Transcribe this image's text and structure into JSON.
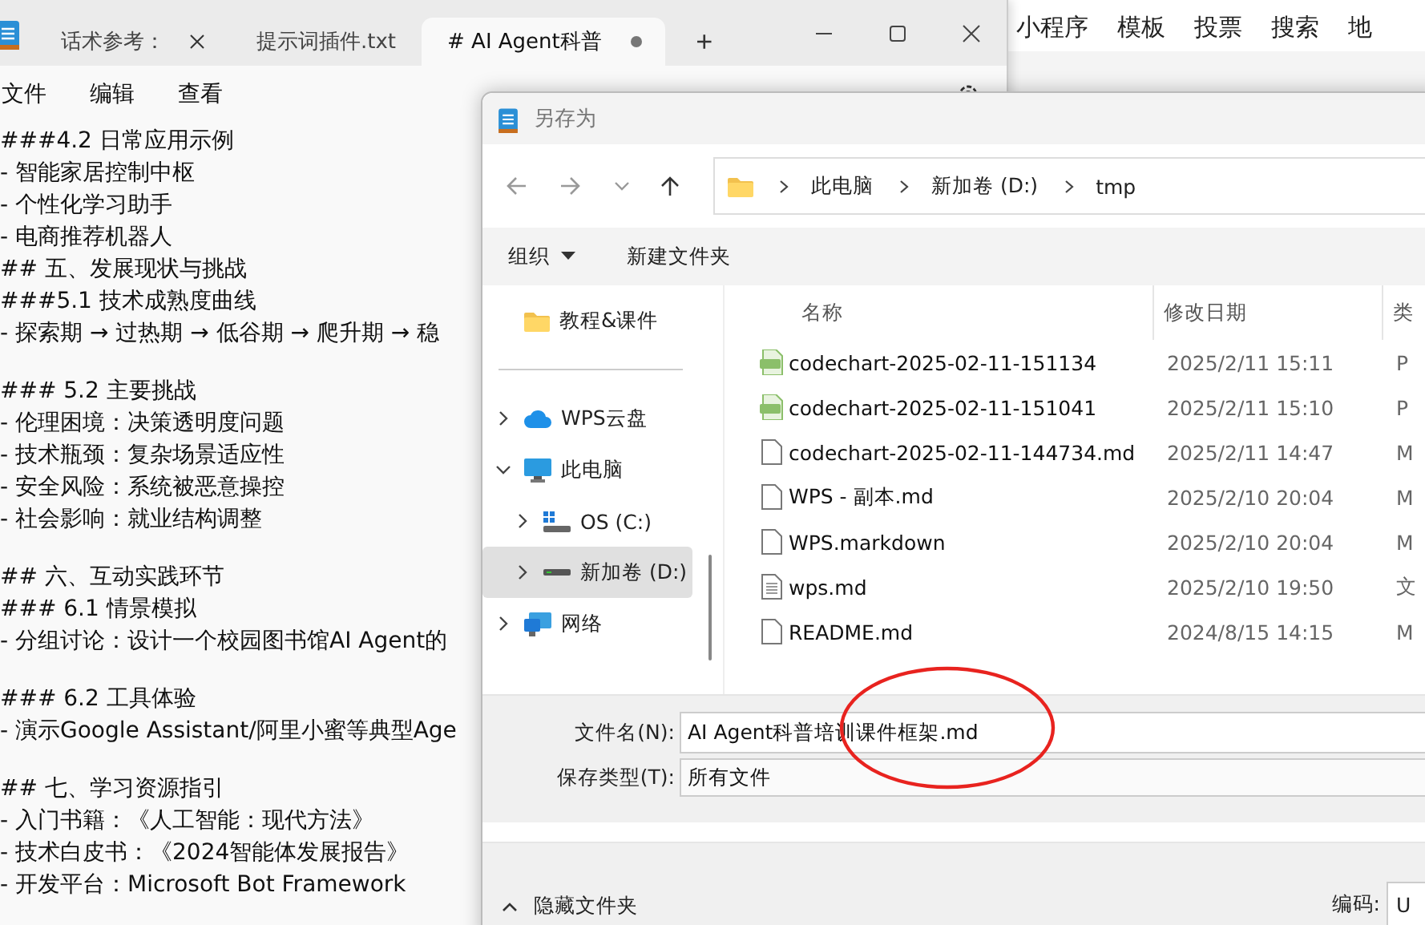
{
  "background_app": {
    "menu": [
      "小程序",
      "模板",
      "投票",
      "搜索",
      "地"
    ]
  },
  "notepad": {
    "tabs": [
      {
        "label": "话术参考：",
        "selected": false,
        "closable": true,
        "unsaved": false
      },
      {
        "label": "提示词插件.txt",
        "selected": false,
        "closable": false,
        "unsaved": false
      },
      {
        "label": "# AI Agent科普",
        "selected": true,
        "closable": false,
        "unsaved": true
      }
    ],
    "add_tab": "+",
    "menu": [
      "文件",
      "编辑",
      "查看"
    ],
    "paragraphs": [
      [
        "###4.2 日常应用示例",
        "- 智能家居控制中枢",
        "- 个性化学习助手",
        "- 电商推荐机器人",
        "## 五、发展现状与挑战",
        "###5.1 技术成熟度曲线",
        "- 探索期 → 过热期 → 低谷期 → 爬升期 → 稳"
      ],
      [
        "### 5.2 主要挑战",
        "- 伦理困境：决策透明度问题",
        "- 技术瓶颈：复杂场景适应性",
        "- 安全风险：系统被恶意操控",
        "- 社会影响：就业结构调整"
      ],
      [
        "## 六、互动实践环节",
        "### 6.1 情景模拟",
        "- 分组讨论：设计一个校园图书馆AI Agent的"
      ],
      [
        "### 6.2 工具体验",
        "- 演示Google Assistant/阿里小蜜等典型Age"
      ],
      [
        "## 七、学习资源指引",
        "- 入门书籍：《人工智能：现代方法》",
        "- 技术白皮书：《2024智能体发展报告》",
        "- 开发平台：Microsoft Bot Framework"
      ]
    ]
  },
  "dialog": {
    "title": "另存为",
    "breadcrumb": [
      "此电脑",
      "新加卷 (D:)",
      "tmp"
    ],
    "toolbar": {
      "organize": "组织",
      "new_folder": "新建文件夹"
    },
    "nav": [
      {
        "label": "教程&课件",
        "kind": "folder",
        "expandable": false,
        "selected": false,
        "child": false
      },
      {
        "label": "WPS云盘",
        "kind": "cloud",
        "expandable": true,
        "expanded": false,
        "selected": false,
        "child": false
      },
      {
        "label": "此电脑",
        "kind": "pc",
        "expandable": true,
        "expanded": true,
        "selected": false,
        "child": false
      },
      {
        "label": "OS (C:)",
        "kind": "os-drive",
        "expandable": true,
        "expanded": false,
        "selected": false,
        "child": true
      },
      {
        "label": "新加卷 (D:)",
        "kind": "drive",
        "expandable": true,
        "expanded": false,
        "selected": true,
        "child": true
      },
      {
        "label": "网络",
        "kind": "network",
        "expandable": true,
        "expanded": false,
        "selected": false,
        "child": false
      }
    ],
    "columns": [
      "名称",
      "修改日期",
      "类"
    ],
    "files": [
      {
        "name": "codechart-2025-02-11-151134",
        "date": "2025/2/11 15:11",
        "type": "P",
        "kind": "png"
      },
      {
        "name": "codechart-2025-02-11-151041",
        "date": "2025/2/11 15:10",
        "type": "P",
        "kind": "png"
      },
      {
        "name": "codechart-2025-02-11-144734.md",
        "date": "2025/2/11 14:47",
        "type": "M",
        "kind": "doc"
      },
      {
        "name": "WPS - 副本.md",
        "date": "2025/2/10 20:04",
        "type": "M",
        "kind": "doc"
      },
      {
        "name": "WPS.markdown",
        "date": "2025/2/10 20:04",
        "type": "M",
        "kind": "doc"
      },
      {
        "name": "wps.md",
        "date": "2025/2/10 19:50",
        "type": "文",
        "kind": "text"
      },
      {
        "name": "README.md",
        "date": "2024/8/15 14:15",
        "type": "M",
        "kind": "doc"
      }
    ],
    "filename_label": "文件名(N):",
    "filename": "AI Agent科普培训课件框架.md",
    "filetype_label": "保存类型(T):",
    "filetype": "所有文件",
    "hide_folders": "隐藏文件夹",
    "encoding_label": "编码:",
    "encoding": "U"
  },
  "annotation": {
    "kind": "circle",
    "color": "#e8231f"
  }
}
